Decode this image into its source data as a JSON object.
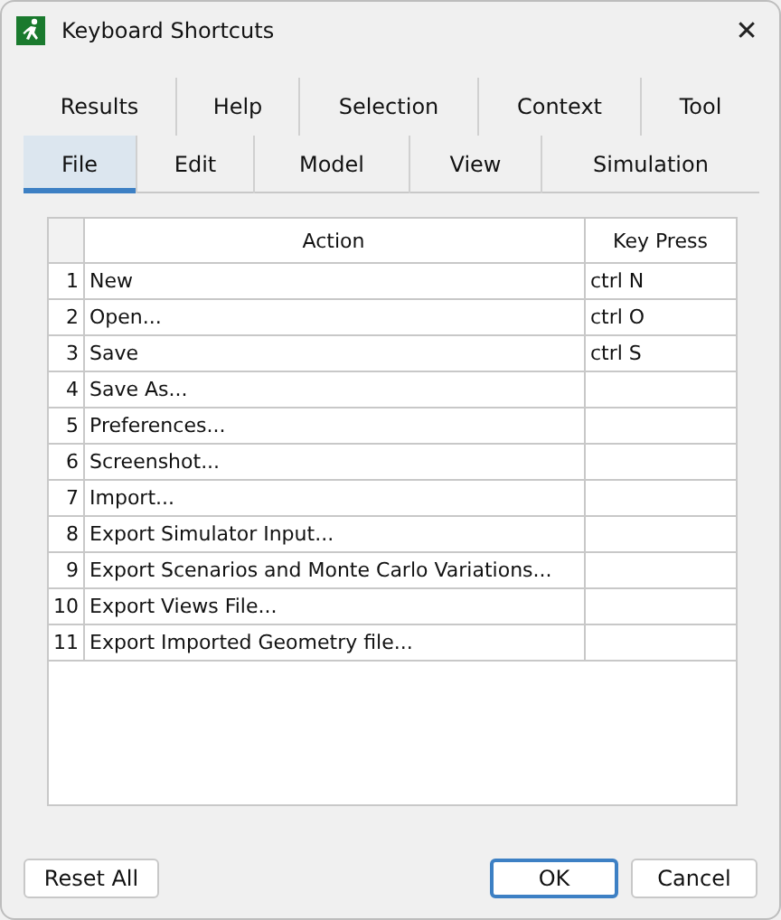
{
  "window": {
    "title": "Keyboard Shortcuts",
    "close": "✕"
  },
  "tab_rows": [
    [
      {
        "label": "Results",
        "selected": false
      },
      {
        "label": "Help",
        "selected": false
      },
      {
        "label": "Selection",
        "selected": false
      },
      {
        "label": "Context",
        "selected": false
      },
      {
        "label": "Tool",
        "selected": false
      }
    ],
    [
      {
        "label": "File",
        "selected": true
      },
      {
        "label": "Edit",
        "selected": false
      },
      {
        "label": "Model",
        "selected": false
      },
      {
        "label": "View",
        "selected": false
      },
      {
        "label": "Simulation",
        "selected": false
      }
    ]
  ],
  "table": {
    "columns": [
      "Action",
      "Key Press"
    ],
    "rows": [
      {
        "number": "1",
        "action": "New",
        "key": "ctrl N"
      },
      {
        "number": "2",
        "action": "Open...",
        "key": "ctrl O"
      },
      {
        "number": "3",
        "action": "Save",
        "key": "ctrl S"
      },
      {
        "number": "4",
        "action": "Save As...",
        "key": ""
      },
      {
        "number": "5",
        "action": "Preferences...",
        "key": ""
      },
      {
        "number": "6",
        "action": "Screenshot...",
        "key": ""
      },
      {
        "number": "7",
        "action": "Import...",
        "key": ""
      },
      {
        "number": "8",
        "action": "Export Simulator Input...",
        "key": ""
      },
      {
        "number": "9",
        "action": "Export Scenarios and Monte Carlo Variations...",
        "key": ""
      },
      {
        "number": "10",
        "action": "Export Views File...",
        "key": ""
      },
      {
        "number": "11",
        "action": "Export Imported Geometry file...",
        "key": ""
      }
    ]
  },
  "buttons": [
    {
      "label": "Reset All",
      "kind": "normal"
    },
    {
      "label": "OK",
      "kind": "default"
    },
    {
      "label": "Cancel",
      "kind": "normal"
    }
  ]
}
